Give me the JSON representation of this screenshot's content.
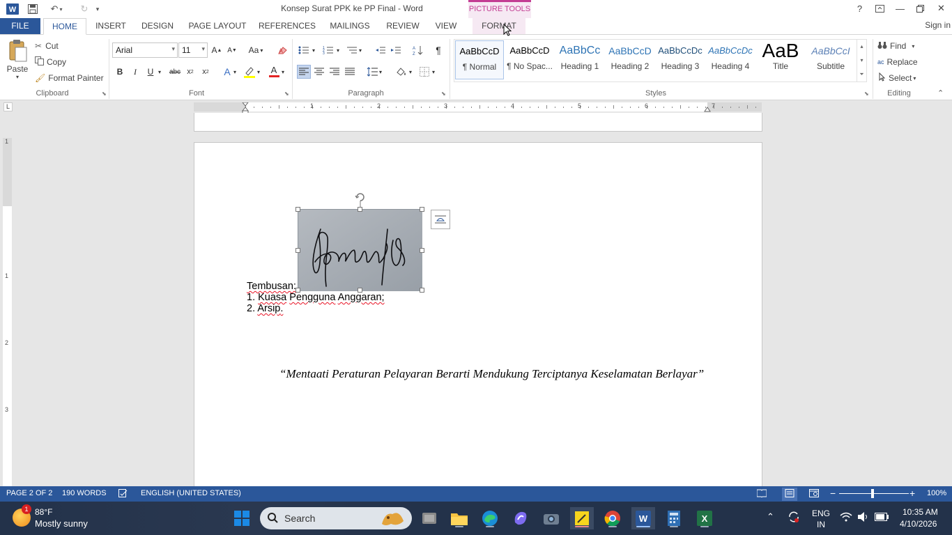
{
  "window": {
    "title": "Konsep Surat PPK ke PP Final - Word",
    "context_tab_group": "PICTURE TOOLS",
    "sign_in": "Sign in"
  },
  "tabs": [
    {
      "label": "FILE"
    },
    {
      "label": "HOME"
    },
    {
      "label": "INSERT"
    },
    {
      "label": "DESIGN"
    },
    {
      "label": "PAGE LAYOUT"
    },
    {
      "label": "REFERENCES"
    },
    {
      "label": "MAILINGS"
    },
    {
      "label": "REVIEW"
    },
    {
      "label": "VIEW"
    },
    {
      "label": "FORMAT"
    }
  ],
  "clipboard": {
    "paste": "Paste",
    "cut": "Cut",
    "copy": "Copy",
    "format_painter": "Format Painter",
    "group_label": "Clipboard"
  },
  "font": {
    "family": "Arial",
    "size": "11",
    "group_label": "Font",
    "change_case": "Aa"
  },
  "paragraph": {
    "group_label": "Paragraph"
  },
  "styles": {
    "group_label": "Styles",
    "items": [
      {
        "sample": "AaBbCcD",
        "name": "¶ Normal"
      },
      {
        "sample": "AaBbCcD",
        "name": "¶ No Spac..."
      },
      {
        "sample": "AaBbCc",
        "name": "Heading 1"
      },
      {
        "sample": "AaBbCcD",
        "name": "Heading 2"
      },
      {
        "sample": "AaBbCcDc",
        "name": "Heading 3"
      },
      {
        "sample": "AaBbCcDc",
        "name": "Heading 4"
      },
      {
        "sample": "AaB",
        "name": "Title"
      },
      {
        "sample": "AaBbCcI",
        "name": "Subtitle"
      }
    ]
  },
  "editing": {
    "find": "Find",
    "replace": "Replace",
    "select": "Select",
    "group_label": "Editing"
  },
  "ruler": {
    "h_numbers": [
      "1",
      "2",
      "3",
      "4",
      "5",
      "6",
      "7"
    ],
    "v_numbers": [
      "1",
      "2",
      "3"
    ]
  },
  "document": {
    "tembusan": "Tembusan:",
    "item1_num": "1.",
    "item1_a": "Kuasa",
    "item1_b": "Pengguna",
    "item1_c": "Anggaran",
    "item1_end": ";",
    "item2_num": "2.",
    "item2": "Arsip",
    "item2_end": ".",
    "motto": "“Mentaati Peraturan Pelayaran Berarti Mendukung Terciptanya Keselamatan Berlayar”"
  },
  "status": {
    "page": "PAGE 2 OF 2",
    "words": "190 WORDS",
    "language": "ENGLISH (UNITED STATES)",
    "zoom": "100%"
  },
  "taskbar": {
    "weather_temp": "88°F",
    "weather_desc": "Mostly sunny",
    "weather_badge": "1",
    "search_placeholder": "Search",
    "lang_top": "ENG",
    "lang_bottom": "IN",
    "time": "10:35 AM",
    "date": "4/10/2026"
  },
  "colors": {
    "word_blue": "#2b579a",
    "picture_tools": "#c33d93",
    "taskbar": "#23324a"
  }
}
